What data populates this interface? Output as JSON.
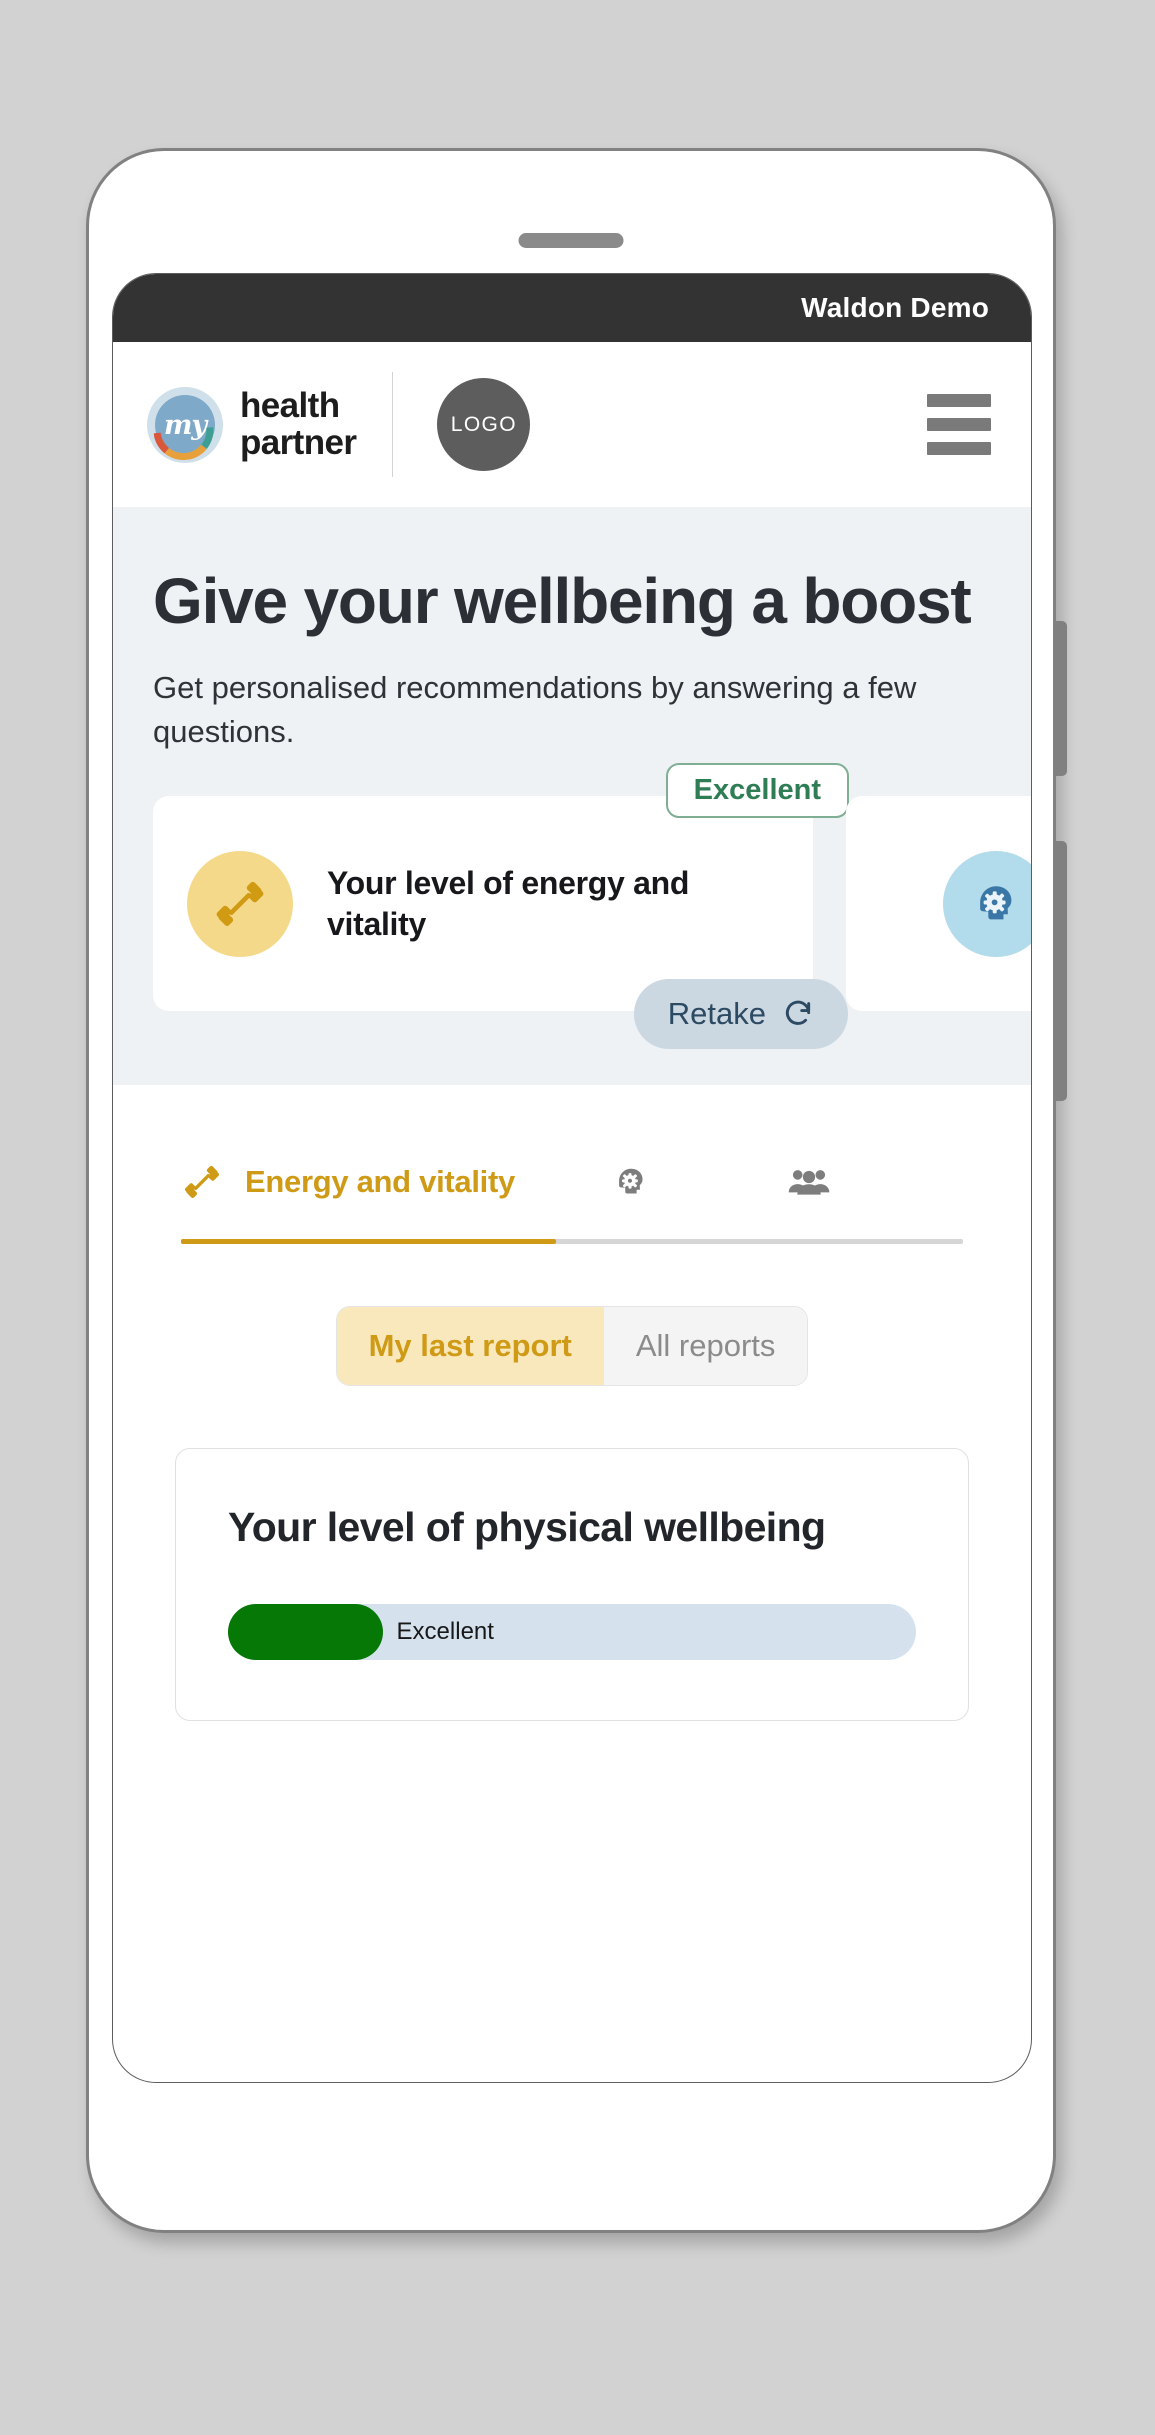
{
  "window": {
    "demo_bar_title": "Waldon Demo"
  },
  "header": {
    "brand_mark_text": "my",
    "brand_line1": "health",
    "brand_line2": "partner",
    "logo_placeholder": "LOGO",
    "menu_icon": "hamburger-menu-icon"
  },
  "hero": {
    "title": "Give your wellbeing a boost",
    "subtitle": "Get personalised recommendations by answering a few questions."
  },
  "score_cards": [
    {
      "icon": "dumbbell-icon",
      "label": "Your level of energy and vitality",
      "badge": "Excellent",
      "action_label": "Retake",
      "action_icon": "refresh-icon"
    },
    {
      "icon": "head-gear-icon",
      "label": "",
      "badge": "",
      "action_label": "",
      "action_icon": ""
    }
  ],
  "tabs": {
    "items": [
      {
        "label": "Energy and vitality",
        "icon": "dumbbell-icon",
        "active": true
      },
      {
        "label": "",
        "icon": "head-gear-icon",
        "active": false
      },
      {
        "label": "",
        "icon": "people-group-icon",
        "active": false
      }
    ],
    "active_underline_percent": 48
  },
  "segmented_control": {
    "options": [
      {
        "label": "My last report",
        "selected": true
      },
      {
        "label": "All reports",
        "selected": false
      }
    ]
  },
  "report": {
    "title": "Your level of physical wellbeing",
    "meter": {
      "value_label": "Excellent",
      "fill_percent": 22.5
    }
  },
  "colors": {
    "accent_gold": "#cf9a16",
    "badge_green": "#2f7d54",
    "meter_green": "#067806",
    "meter_track": "#d5e2ee",
    "hero_bg": "#eef2f4",
    "demo_bar_bg": "#333333"
  },
  "chart_data": {
    "type": "bar",
    "title": "Your level of physical wellbeing",
    "categories": [
      "Physical wellbeing"
    ],
    "values": [
      22.5
    ],
    "value_labels": [
      "Excellent"
    ],
    "ylim": [
      0,
      100
    ],
    "xlabel": "",
    "ylabel": "",
    "grid": false,
    "legend": "none"
  }
}
